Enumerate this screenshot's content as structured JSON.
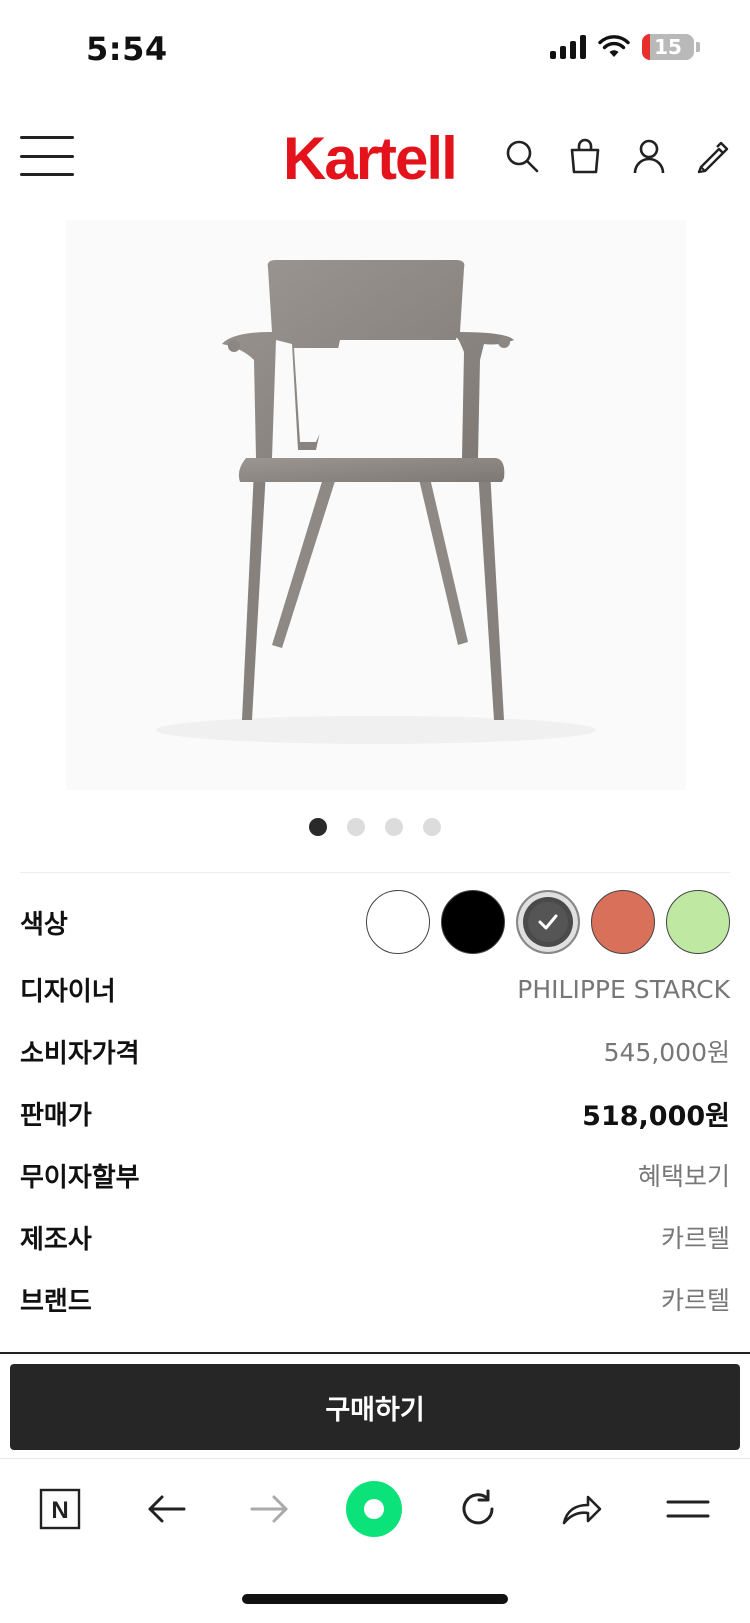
{
  "status_bar": {
    "time": "5:54",
    "battery_level": "15"
  },
  "header": {
    "logo": "Kartell",
    "brand_color": "#e4131b",
    "icons": [
      "hamburger-menu-icon",
      "search-icon",
      "shopping-bag-icon",
      "user-icon",
      "pencil-icon"
    ]
  },
  "gallery": {
    "page_count": 4,
    "active_index": 0
  },
  "product": {
    "color_label": "색상",
    "colors": [
      {
        "name": "white",
        "hex": "#ffffff",
        "selected": false
      },
      {
        "name": "black",
        "hex": "#000000",
        "selected": false
      },
      {
        "name": "metal-grey",
        "hex": "#4a4a4a",
        "selected": true
      },
      {
        "name": "orange",
        "hex": "#d9705a",
        "selected": false
      },
      {
        "name": "light-green",
        "hex": "#bfe9a3",
        "selected": false
      }
    ],
    "designer_label": "디자이너",
    "designer_value": "PHILIPPE STARCK",
    "consumer_price_label": "소비자가격",
    "consumer_price_value": "545,000원",
    "sale_price_label": "판매가",
    "sale_price_value": "518,000원",
    "installment_label": "무이자할부",
    "installment_value": "혜택보기",
    "manufacturer_label": "제조사",
    "manufacturer_value": "카르텔",
    "brand_label": "브랜드",
    "brand_value": "카르텔"
  },
  "buy_button": {
    "label": "구매하기"
  },
  "browser_toolbar": {
    "icons": [
      "naver-n-icon",
      "back-arrow-icon",
      "forward-arrow-icon",
      "green-dot-icon",
      "refresh-icon",
      "share-icon",
      "menu-icon"
    ],
    "naver_letter": "N"
  }
}
